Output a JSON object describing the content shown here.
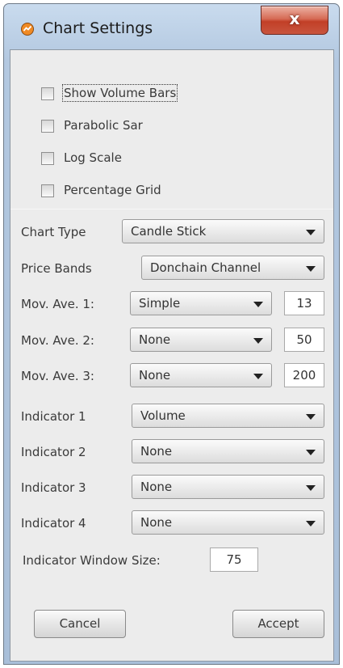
{
  "window": {
    "title": "Chart Settings",
    "close_label": "x",
    "icon": "app-chart-icon",
    "accent_color": "#c8553e"
  },
  "checkboxes": [
    {
      "label": "Show Volume Bars",
      "checked": false
    },
    {
      "label": "Parabolic Sar",
      "checked": false
    },
    {
      "label": "Log Scale",
      "checked": false
    },
    {
      "label": "Percentage Grid",
      "checked": false
    }
  ],
  "settings": {
    "chart_type": {
      "label": "Chart Type",
      "value": "Candle Stick"
    },
    "price_bands": {
      "label": "Price Bands",
      "value": "Donchain Channel"
    },
    "mov_ave": [
      {
        "label": "Mov. Ave. 1:",
        "value": "Simple",
        "period": "13"
      },
      {
        "label": "Mov. Ave. 2:",
        "value": "None",
        "period": "50"
      },
      {
        "label": "Mov. Ave. 3:",
        "value": "None",
        "period": "200"
      }
    ],
    "indicators": [
      {
        "label": "Indicator 1",
        "value": "Volume"
      },
      {
        "label": "Indicator 2",
        "value": "None"
      },
      {
        "label": "Indicator 3",
        "value": "None"
      },
      {
        "label": "Indicator 4",
        "value": "None"
      }
    ],
    "window_size": {
      "label": "Indicator Window Size:",
      "value": "75"
    }
  },
  "buttons": {
    "cancel": "Cancel",
    "accept": "Accept"
  }
}
